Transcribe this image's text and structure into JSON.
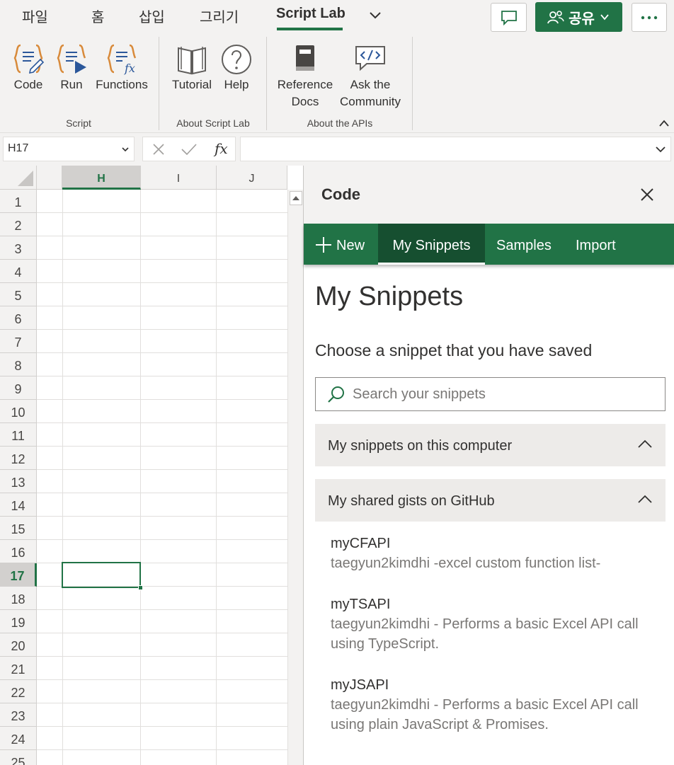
{
  "ribbon_tabs": [
    "파일",
    "홈",
    "삽입",
    "그리기",
    "Script Lab"
  ],
  "active_tab_index": 4,
  "share_label": "공유",
  "accent_color": "#217346",
  "commands": {
    "code": "Code",
    "run": "Run",
    "functions": "Functions",
    "tutorial": "Tutorial",
    "help": "Help",
    "reference_line1": "Reference",
    "reference_line2": "Docs",
    "community_line1": "Ask the",
    "community_line2": "Community"
  },
  "groups": {
    "script": "Script",
    "about_script_lab": "About Script Lab",
    "about_apis": "About the APIs"
  },
  "formula_bar": {
    "name_box": "H17",
    "fx": "fx",
    "value": ""
  },
  "grid": {
    "columns": [
      "H",
      "I",
      "J"
    ],
    "selected_column": "H",
    "rows": [
      "1",
      "2",
      "3",
      "4",
      "5",
      "6",
      "7",
      "8",
      "9",
      "10",
      "11",
      "12",
      "13",
      "14",
      "15",
      "16",
      "17",
      "18",
      "19",
      "20",
      "21",
      "22",
      "23",
      "24",
      "25"
    ],
    "selected_row": "17"
  },
  "pane": {
    "title": "Code",
    "nav": {
      "new": "New",
      "my_snippets": "My Snippets",
      "samples": "Samples",
      "import": "Import"
    },
    "heading": "My Snippets",
    "subheading": "Choose a snippet that you have saved",
    "search_placeholder": "Search your snippets",
    "sections": {
      "local": "My snippets on this computer",
      "gists": "My shared gists on GitHub"
    },
    "snippets": [
      {
        "name": "myCFAPI",
        "desc1": "taegyun2kimdhi -excel custom function list-",
        "desc2": ""
      },
      {
        "name": "myTSAPI",
        "desc1": "taegyun2kimdhi - Performs a basic Excel API call",
        "desc2": "using TypeScript."
      },
      {
        "name": "myJSAPI",
        "desc1": "taegyun2kimdhi - Performs a basic Excel API call",
        "desc2": "using plain JavaScript & Promises."
      }
    ]
  }
}
